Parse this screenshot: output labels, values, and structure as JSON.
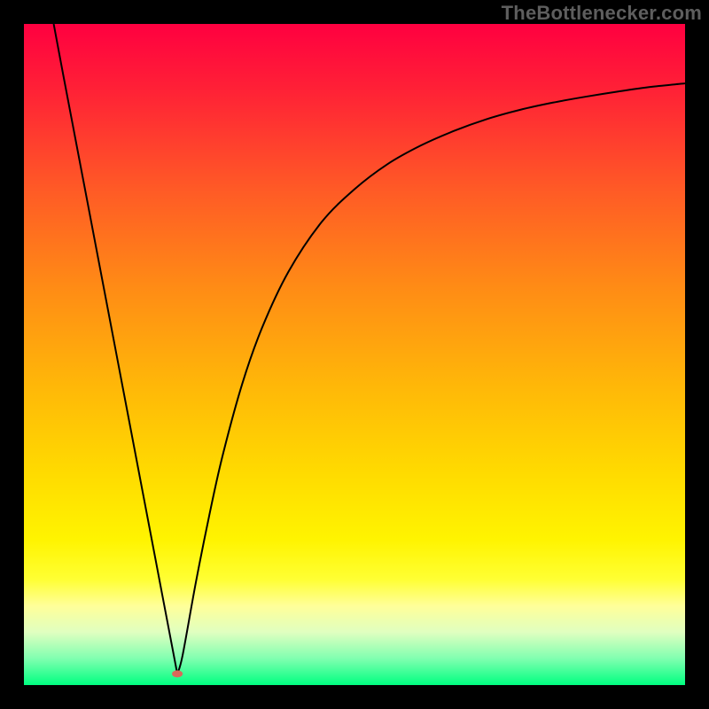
{
  "watermark": "TheBottlenecker.com",
  "chart_data": {
    "type": "line",
    "title": "",
    "xlabel": "",
    "ylabel": "",
    "xlim": [
      0,
      100
    ],
    "ylim": [
      0,
      100
    ],
    "background_gradient": {
      "stops": [
        {
          "offset": 0.0,
          "color": "#ff0040"
        },
        {
          "offset": 0.1,
          "color": "#ff2136"
        },
        {
          "offset": 0.25,
          "color": "#ff5a26"
        },
        {
          "offset": 0.4,
          "color": "#ff8c15"
        },
        {
          "offset": 0.55,
          "color": "#ffb808"
        },
        {
          "offset": 0.68,
          "color": "#ffdb00"
        },
        {
          "offset": 0.78,
          "color": "#fff400"
        },
        {
          "offset": 0.84,
          "color": "#ffff33"
        },
        {
          "offset": 0.88,
          "color": "#ffff99"
        },
        {
          "offset": 0.92,
          "color": "#e0ffc0"
        },
        {
          "offset": 0.96,
          "color": "#80ffb0"
        },
        {
          "offset": 1.0,
          "color": "#00ff80"
        }
      ]
    },
    "series": [
      {
        "name": "curve",
        "color": "#000000",
        "stroke_width": 2,
        "x": [
          4.5,
          6,
          8,
          10,
          12,
          14,
          16,
          18,
          20,
          22,
          23.2,
          24,
          26,
          28,
          30,
          33,
          36,
          40,
          45,
          50,
          55,
          60,
          65,
          70,
          75,
          80,
          85,
          90,
          95,
          100
        ],
        "y": [
          100,
          92,
          81.5,
          71,
          60.5,
          50,
          39.5,
          29,
          18.5,
          8,
          1.7,
          4.5,
          15.5,
          25.5,
          34.5,
          45.5,
          54,
          62.5,
          70,
          75,
          78.8,
          81.6,
          83.8,
          85.6,
          87.0,
          88.1,
          89.0,
          89.8,
          90.5,
          91.0
        ]
      }
    ],
    "markers": [
      {
        "name": "min-marker",
        "x": 23.2,
        "y": 1.7,
        "rx": 6,
        "ry": 4,
        "fill": "#d96a5a"
      }
    ]
  }
}
